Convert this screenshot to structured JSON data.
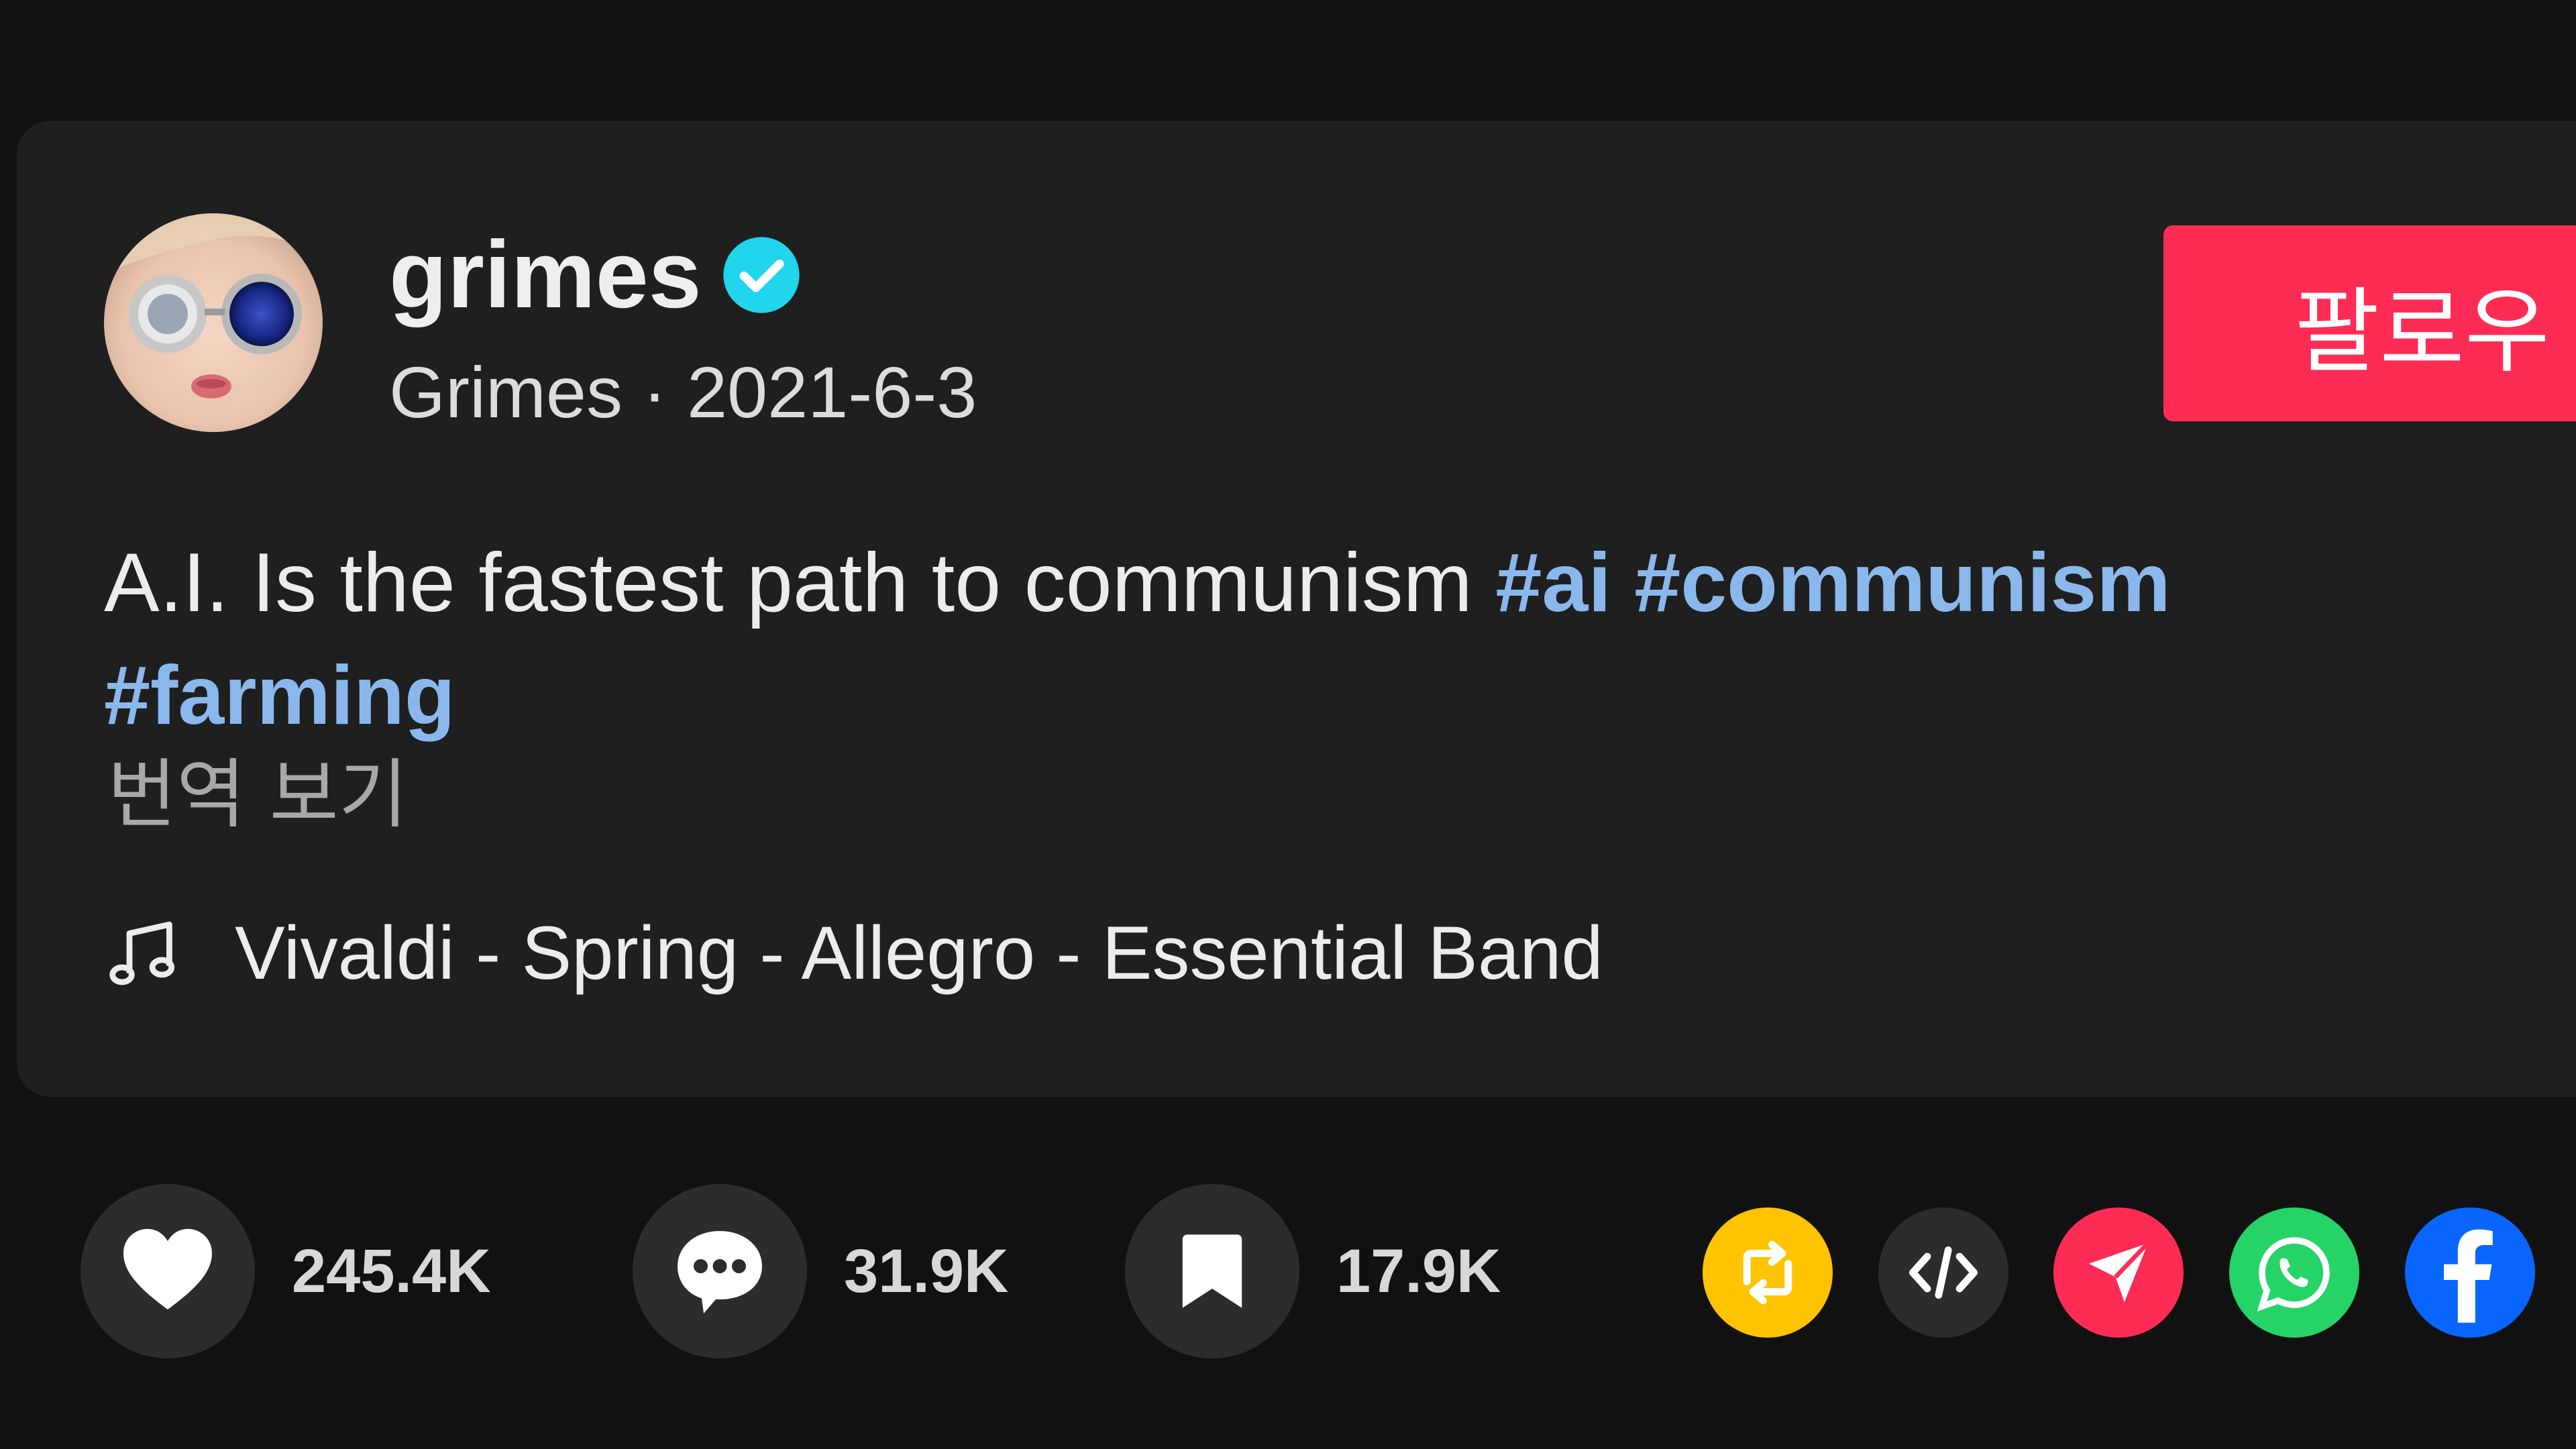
{
  "post": {
    "username": "grimes",
    "display_name": "Grimes",
    "date": "2021-6-3",
    "meta_separator": " · ",
    "follow_label": "팔로우",
    "caption_text": "A.I. Is the fastest path to communism ",
    "hashtags": [
      "#ai",
      "#communism",
      "#farming"
    ],
    "translate_label": "번역 보기",
    "music": "Vivaldi - Spring - Allegro - Essential Band"
  },
  "actions": {
    "likes": "245.4K",
    "comments": "31.9K",
    "saves": "17.9K"
  },
  "icons": {
    "verified": "verified-badge-icon",
    "music": "music-note-icon",
    "like": "heart-icon",
    "comment": "comment-icon",
    "save": "bookmark-icon",
    "repost": "repost-icon",
    "embed": "embed-code-icon",
    "send": "send-icon",
    "whatsapp": "whatsapp-icon",
    "facebook": "facebook-icon"
  },
  "colors": {
    "background": "#111111",
    "card": "#1f1f1f",
    "follow_button": "#fe2c55",
    "hashtag": "#8ab8ec",
    "verified": "#20d5ec",
    "repost": "#ffc300",
    "embed": "#2c2c2c",
    "send": "#fe2c55",
    "whatsapp": "#25d366",
    "facebook": "#0866ff"
  }
}
